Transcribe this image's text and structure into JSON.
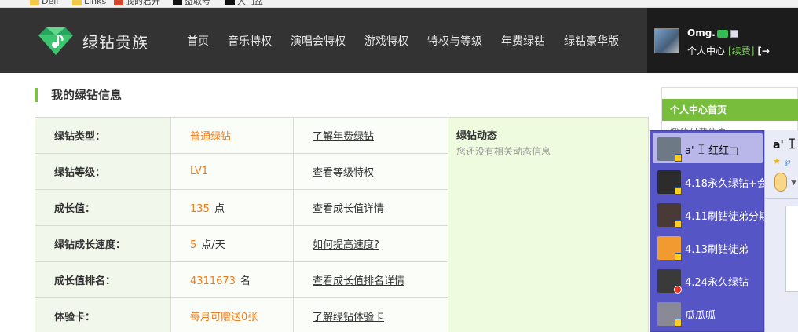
{
  "bookmarks": [
    {
      "label": "Dell",
      "icon": "folder-icon"
    },
    {
      "label": "Links",
      "icon": "folder-icon"
    },
    {
      "label": "我的君开",
      "icon": "app-icon"
    },
    {
      "label": "盗取号",
      "icon": "black-icon"
    },
    {
      "label": "大门盆",
      "icon": "black-icon"
    }
  ],
  "header": {
    "logo_text": "绿钻贵族",
    "nav": [
      "首页",
      "音乐特权",
      "演唱会特权",
      "游戏特权",
      "特权与等级",
      "年费绿钻",
      "绿钻豪华版"
    ]
  },
  "user": {
    "name": "Omg.",
    "center_label": "个人中心",
    "renew_label": "[续费]",
    "logout_icon": "logout-icon"
  },
  "section": {
    "title": "我的绿钻信息"
  },
  "info": {
    "rows": [
      {
        "label": "绿钻类型：",
        "value": "普通绿钻",
        "unit": "",
        "link": "了解年费绿钻"
      },
      {
        "label": "绿钻等级：",
        "value": "LV1",
        "unit": "",
        "link": "查看等级特权"
      },
      {
        "label": "成长值：",
        "value": "135",
        "unit": "点",
        "link": "查看成长值详情"
      },
      {
        "label": "绿钻成长速度：",
        "value": "5",
        "unit": "点/天",
        "link": "如何提高速度?"
      },
      {
        "label": "成长值排名：",
        "value": "4311673",
        "unit": "名",
        "link": "查看成长值排名详情"
      },
      {
        "label": "体验卡：",
        "value": "每月可赠送0张",
        "unit": "",
        "link": "了解绿钻体验卡"
      }
    ],
    "dynamics_title": "绿钻动态",
    "dynamics_text": "您还没有相关动态信息"
  },
  "side_panel": {
    "title": "个人中心首页",
    "sub": "我的付费信息"
  },
  "chat": {
    "contacts": [
      {
        "name": "a' ꀤ      红红□",
        "selected": true,
        "avatar_color": "#6d7a86",
        "mark": "yellow"
      },
      {
        "name": "4.18永久绿钻+会",
        "selected": false,
        "avatar_color": "#2c2c2c",
        "mark": "yellow"
      },
      {
        "name": "4.11刷钻徒弟分期",
        "selected": false,
        "avatar_color": "#4a3a36",
        "mark": "yellow"
      },
      {
        "name": "4.13刷钻徒弟",
        "selected": false,
        "avatar_color": "#f09a30",
        "mark": "yellow"
      },
      {
        "name": "4.24永久绿钻",
        "selected": false,
        "avatar_color": "#3a3a3a",
        "mark": "red"
      },
      {
        "name": "瓜瓜呱",
        "selected": false,
        "avatar_color": "#8a8a96",
        "mark": "yellow"
      }
    ],
    "window_name": "a' ꀤ"
  },
  "colors": {
    "accent_green": "#7dc242",
    "value_orange": "#ef7d1e",
    "header_bg": "#333333",
    "chat_bg": "#5655c6"
  }
}
